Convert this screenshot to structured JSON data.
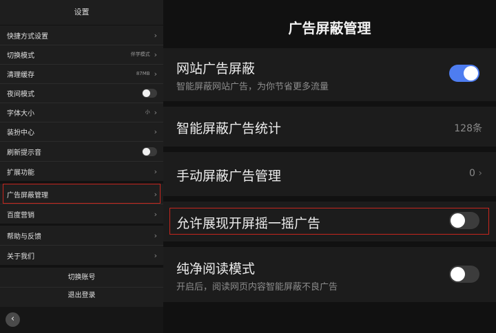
{
  "settings": {
    "title": "设置",
    "items": [
      {
        "label": "快捷方式设置",
        "value": "",
        "control": "chevron"
      },
      {
        "label": "切换模式",
        "value": "伴学模式",
        "control": "chevron"
      },
      {
        "label": "清理缓存",
        "value": "87MB",
        "control": "chevron"
      },
      {
        "label": "夜间模式",
        "value": "",
        "control": "toggle",
        "state": "off"
      },
      {
        "label": "字体大小",
        "value": "小",
        "control": "chevron"
      },
      {
        "label": "装扮中心",
        "value": "",
        "control": "chevron"
      },
      {
        "label": "刷新提示音",
        "value": "",
        "control": "toggle",
        "state": "off"
      },
      {
        "label": "扩展功能",
        "value": "",
        "control": "chevron"
      },
      {
        "label": "广告屏蔽管理",
        "value": "",
        "control": "chevron",
        "highlighted": true
      },
      {
        "label": "百度营销",
        "value": "",
        "control": "chevron"
      },
      {
        "label": "帮助与反馈",
        "value": "",
        "control": "chevron"
      },
      {
        "label": "关于我们",
        "value": "",
        "control": "chevron"
      }
    ],
    "switch_account": "切换账号",
    "logout": "退出登录",
    "back_icon": "chevron-left-icon"
  },
  "ad_block": {
    "title": "广告屏蔽管理",
    "website_block": {
      "title": "网站广告屏蔽",
      "subtitle": "智能屏蔽网站广告，为你节省更多流量",
      "state": "on"
    },
    "stats": {
      "title": "智能屏蔽广告统计",
      "value": "128条"
    },
    "manual": {
      "title": "手动屏蔽广告管理",
      "value": "0"
    },
    "shake": {
      "title": "允许展现开屏摇一摇广告",
      "state": "off"
    },
    "pure_read": {
      "title": "纯净阅读模式",
      "subtitle": "开启后，阅读网页内容智能屏蔽不良广告",
      "state": "off"
    }
  },
  "colors": {
    "accent": "#4e7df0",
    "highlight_border": "#c8261e"
  }
}
